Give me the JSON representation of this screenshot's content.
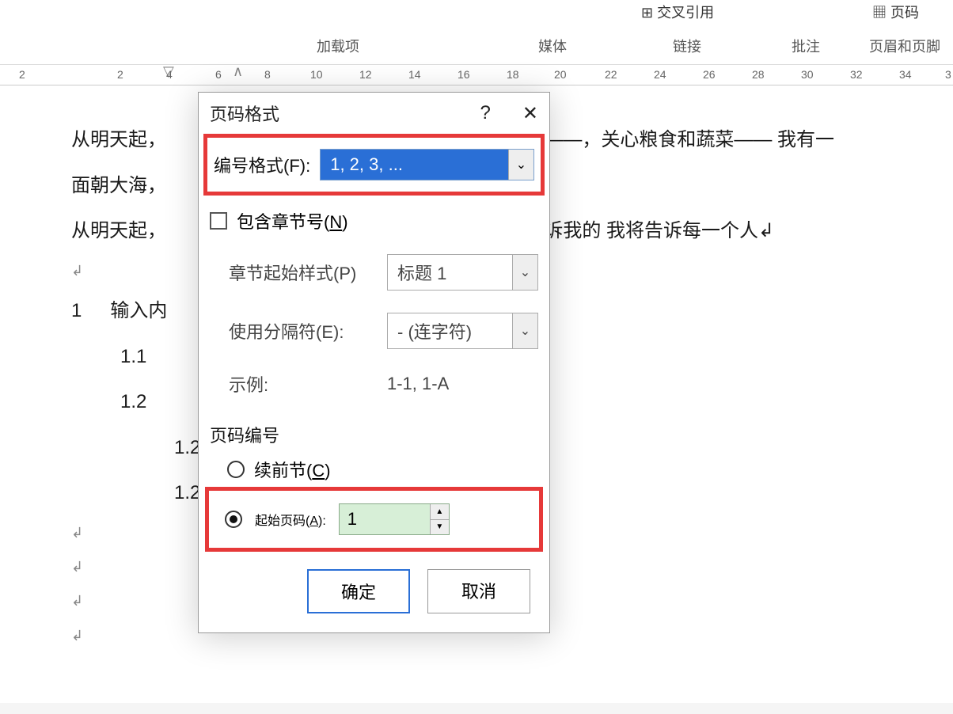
{
  "ribbon": {
    "top_cross_ref": "交叉引用",
    "top_pagenum": "页码",
    "groups": {
      "addins": "加载项",
      "media": "媒体",
      "links": "链接",
      "comments": "批注",
      "headerfooter": "页眉和页脚"
    }
  },
  "ruler": {
    "left": "2",
    "ticks": [
      "2",
      "4",
      "6",
      "8",
      "10",
      "12",
      "14",
      "16",
      "18",
      "20",
      "22",
      "24",
      "26",
      "28",
      "30",
      "32",
      "34",
      "3"
    ]
  },
  "document": {
    "line1_a": "从明天起，",
    "line1_b": "起——，关心粮食和蔬菜——  我有一",
    "line2": "面朝大海，",
    "line3_a": "从明天起，",
    "line3_b": "告诉我的  我将告诉每一个人↲",
    "blank": "↲",
    "h1_num": "1",
    "h1_text": "输入内",
    "h11": "1.1",
    "h12": "1.2",
    "h121": "1.2",
    "h122": "1.2"
  },
  "dialog": {
    "title": "页码格式",
    "help": "?",
    "close": "✕",
    "number_format_label": "编号格式(F):",
    "number_format_value": "1, 2, 3, ...",
    "include_chapter": "包含章节号(N)",
    "chapter_start_label": "章节起始样式(P)",
    "chapter_start_value": "标题 1",
    "separator_label": "使用分隔符(E):",
    "separator_value": "-  (连字符)",
    "example_label": "示例:",
    "example_value": "1-1, 1-A",
    "page_numbering": "页码编号",
    "continue_prev": "续前节(C)",
    "start_at_label": "起始页码(A):",
    "start_at_value": "1",
    "ok": "确定",
    "cancel": "取消"
  }
}
